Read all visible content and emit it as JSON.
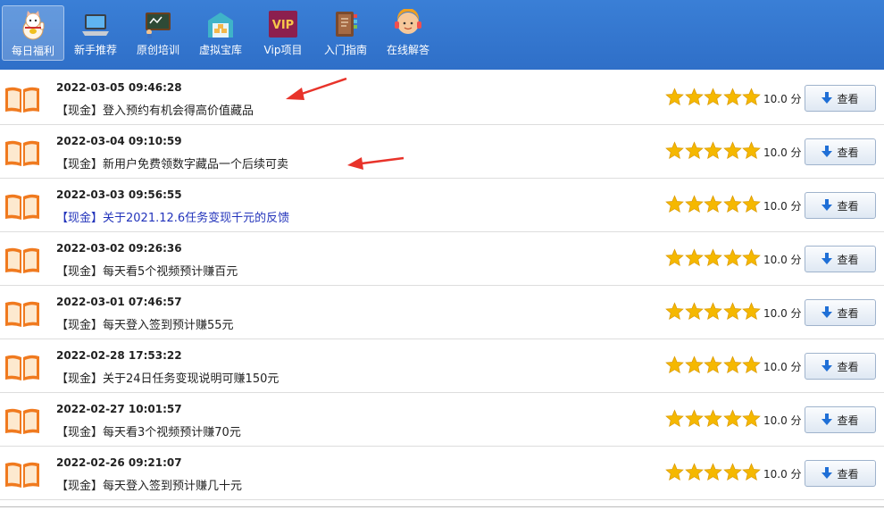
{
  "nav": {
    "items": [
      {
        "label": "每日福利",
        "icon": "lucky-cat-icon",
        "active": true
      },
      {
        "label": "新手推荐",
        "icon": "laptop-icon",
        "active": false
      },
      {
        "label": "原创培训",
        "icon": "chalkboard-icon",
        "active": false
      },
      {
        "label": "虚拟宝库",
        "icon": "warehouse-icon",
        "active": false
      },
      {
        "label": "Vip项目",
        "icon": "vip-badge-icon",
        "active": false
      },
      {
        "label": "入门指南",
        "icon": "guide-book-icon",
        "active": false
      },
      {
        "label": "在线解答",
        "icon": "support-agent-icon",
        "active": false
      }
    ],
    "vip_badge_text": "VIP"
  },
  "list": {
    "rows": [
      {
        "date": "2022-03-05 09:46:28",
        "title": "【现金】登入预约有机会得高价值藏品",
        "rating": 5,
        "score": "10.0 分",
        "button": "查看",
        "visited": false
      },
      {
        "date": "2022-03-04 09:10:59",
        "title": "【现金】新用户免费领数字藏品一个后续可卖",
        "rating": 5,
        "score": "10.0 分",
        "button": "查看",
        "visited": false
      },
      {
        "date": "2022-03-03 09:56:55",
        "title": "【现金】关于2021.12.6任务变现千元的反馈",
        "rating": 5,
        "score": "10.0 分",
        "button": "查看",
        "visited": true
      },
      {
        "date": "2022-03-02 09:26:36",
        "title": "【现金】每天看5个视频预计赚百元",
        "rating": 5,
        "score": "10.0 分",
        "button": "查看",
        "visited": false
      },
      {
        "date": "2022-03-01 07:46:57",
        "title": "【现金】每天登入签到预计赚55元",
        "rating": 5,
        "score": "10.0 分",
        "button": "查看",
        "visited": false
      },
      {
        "date": "2022-02-28 17:53:22",
        "title": "【现金】关于24日任务变现说明可赚150元",
        "rating": 5,
        "score": "10.0 分",
        "button": "查看",
        "visited": false
      },
      {
        "date": "2022-02-27 10:01:57",
        "title": "【现金】每天看3个视频预计赚70元",
        "rating": 5,
        "score": "10.0 分",
        "button": "查看",
        "visited": false
      },
      {
        "date": "2022-02-26 09:21:07",
        "title": "【现金】每天登入签到预计赚几十元",
        "rating": 5,
        "score": "10.0 分",
        "button": "查看",
        "visited": false
      }
    ]
  },
  "colors": {
    "topbar": "#2f6fc8",
    "star": "#f5b800",
    "book": "#f07a1f",
    "link": "#2233bb",
    "annotation_arrow": "#e8332a"
  }
}
